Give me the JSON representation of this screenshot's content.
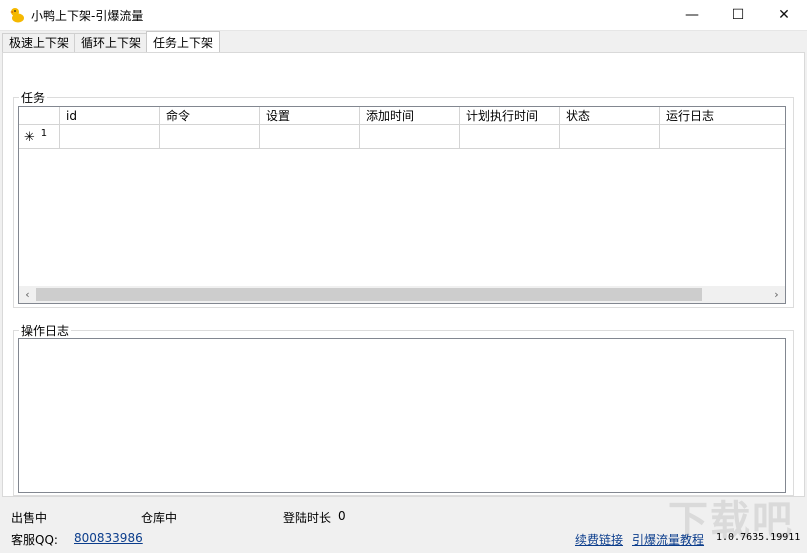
{
  "window": {
    "title": "小鸭上下架-引爆流量",
    "minimize_glyph": "—",
    "maximize_glyph": "☐",
    "close_glyph": "✕"
  },
  "tabs": [
    {
      "label": "极速上下架",
      "active": false
    },
    {
      "label": "循环上下架",
      "active": false
    },
    {
      "label": "任务上下架",
      "active": true
    }
  ],
  "tasks": {
    "group_label": "任务",
    "columns": [
      "id",
      "命令",
      "设置",
      "添加时间",
      "计划执行时间",
      "状态",
      "运行日志"
    ],
    "new_row": {
      "marker": "✳",
      "index": "1"
    }
  },
  "log": {
    "group_label": "操作日志"
  },
  "status": {
    "selling": "出售中",
    "warehouse": "仓库中",
    "login_duration_label": "登陆时长",
    "login_duration_value": "0",
    "support_label": "客服QQ:",
    "support_qq": "800833986",
    "renew_link": "续费链接",
    "tutorial_link": "引爆流量教程",
    "version": "1.0.7635.19911"
  },
  "watermark": "下载吧",
  "colors": {
    "link": "#0b3d8c",
    "grid_border": "#828790",
    "app_icon": "#f5b800"
  }
}
